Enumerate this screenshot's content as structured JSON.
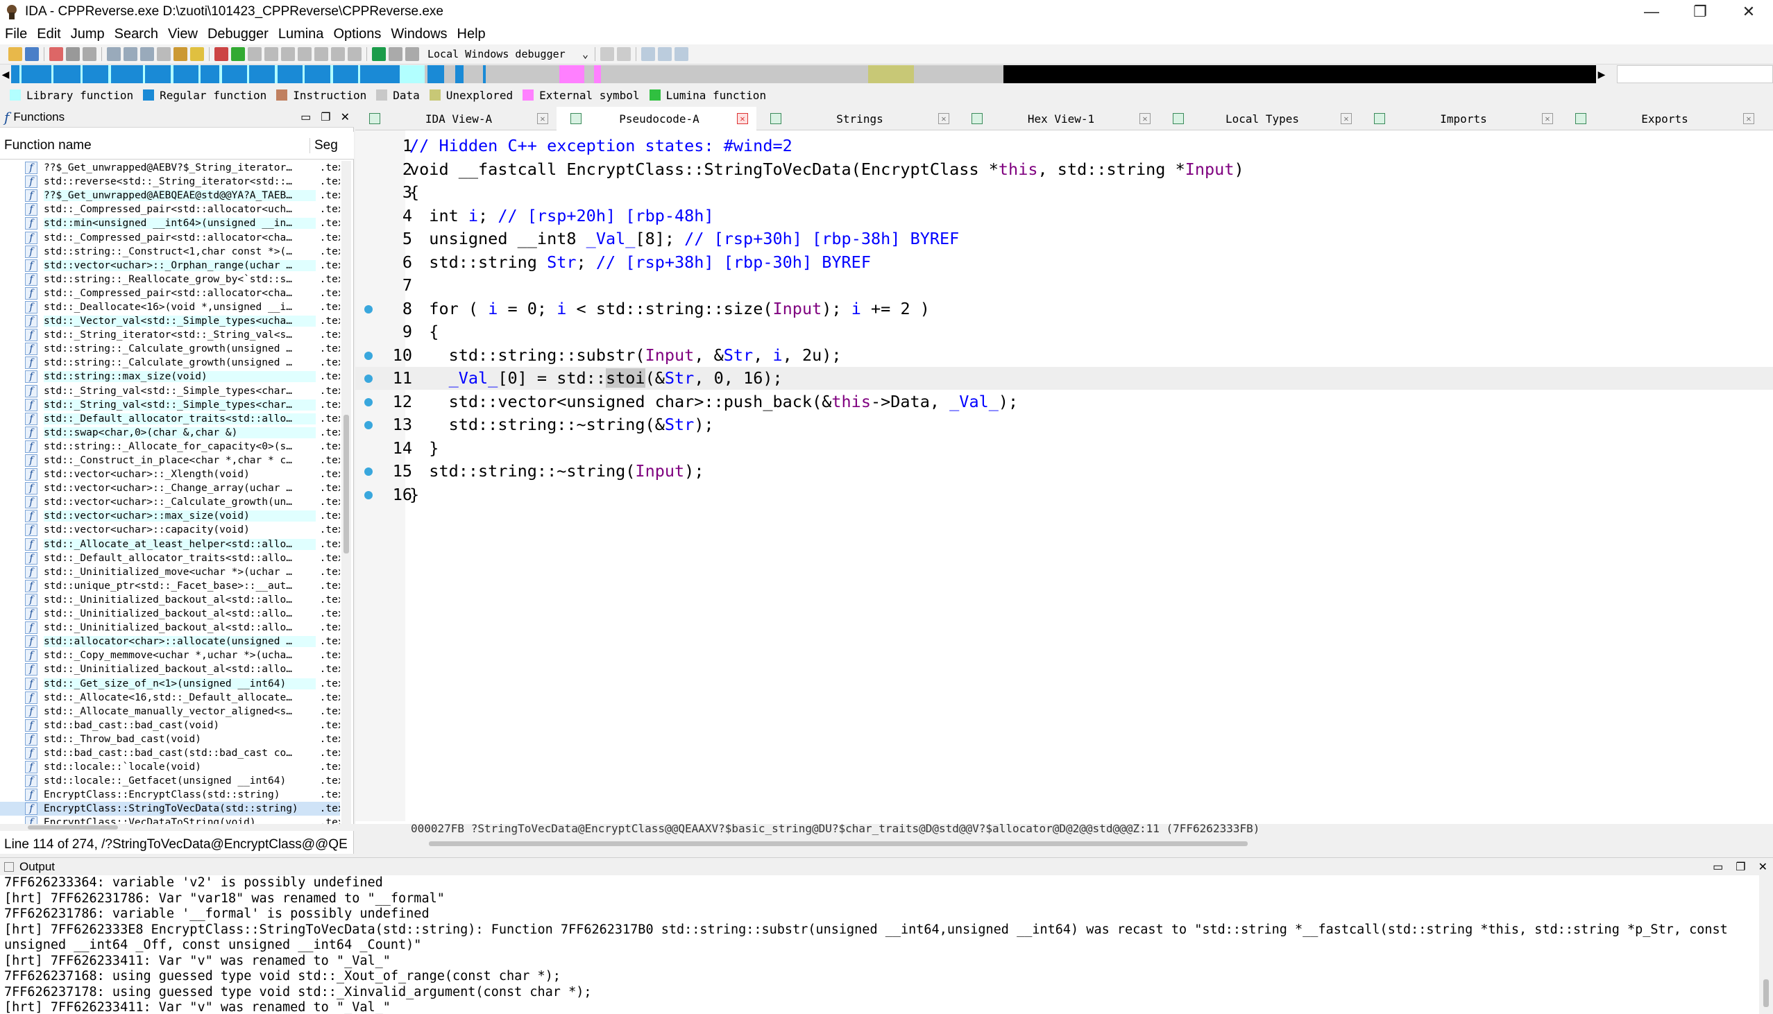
{
  "window": {
    "title": "IDA - CPPReverse.exe D:\\zuoti\\101423_CPPReverse\\CPPReverse.exe",
    "minimize_glyph": "—",
    "maximize_glyph": "❐",
    "close_glyph": "✕"
  },
  "menu": [
    "File",
    "Edit",
    "Jump",
    "Search",
    "View",
    "Debugger",
    "Lumina",
    "Options",
    "Windows",
    "Help"
  ],
  "toolbar": {
    "debugger": "Local Windows debugger"
  },
  "legend": [
    {
      "label": "Library function",
      "color": "#b2ffff"
    },
    {
      "label": "Regular function",
      "color": "#1a8ad6"
    },
    {
      "label": "Instruction",
      "color": "#c08060"
    },
    {
      "label": "Data",
      "color": "#c8c8c8"
    },
    {
      "label": "Unexplored",
      "color": "#c8c876"
    },
    {
      "label": "External symbol",
      "color": "#ff80ff"
    },
    {
      "label": "Lumina function",
      "color": "#30c040"
    }
  ],
  "functions": {
    "title": "Functions",
    "col_name": "Function name",
    "col_seg": "Seg",
    "items": [
      {
        "name": "??$_Get_unwrapped@AEBV?$_String_iterator…",
        "seg": ".tex",
        "lib": false
      },
      {
        "name": "std::reverse<std::_String_iterator<std::…",
        "seg": ".tex",
        "lib": false
      },
      {
        "name": "??$_Get_unwrapped@AEBQEAE@std@@YA?A_TAEB…",
        "seg": ".tex",
        "lib": true
      },
      {
        "name": "std::_Compressed_pair<std::allocator<uch…",
        "seg": ".tex",
        "lib": false
      },
      {
        "name": "std::min<unsigned __int64>(unsigned __in…",
        "seg": ".tex",
        "lib": true
      },
      {
        "name": "std::_Compressed_pair<std::allocator<cha…",
        "seg": ".tex",
        "lib": false
      },
      {
        "name": "std::string::_Construct<1,char const *>(…",
        "seg": ".tex",
        "lib": false
      },
      {
        "name": "std::vector<uchar>::_Orphan_range(uchar …",
        "seg": ".tex",
        "lib": true
      },
      {
        "name": "std::string::_Reallocate_grow_by<`std::s…",
        "seg": ".tex",
        "lib": false
      },
      {
        "name": "std::_Compressed_pair<std::allocator<cha…",
        "seg": ".tex",
        "lib": false
      },
      {
        "name": "std::_Deallocate<16>(void *,unsigned __i…",
        "seg": ".tex",
        "lib": false
      },
      {
        "name": "std::_Vector_val<std::_Simple_types<ucha…",
        "seg": ".tex",
        "lib": true
      },
      {
        "name": "std::_String_iterator<std::_String_val<s…",
        "seg": ".tex",
        "lib": false
      },
      {
        "name": "std::string::_Calculate_growth(unsigned …",
        "seg": ".tex",
        "lib": false
      },
      {
        "name": "std::string::_Calculate_growth(unsigned …",
        "seg": ".tex",
        "lib": false
      },
      {
        "name": "std::string::max_size(void)",
        "seg": ".tex",
        "lib": true
      },
      {
        "name": "std::_String_val<std::_Simple_types<char…",
        "seg": ".tex",
        "lib": false
      },
      {
        "name": "std::_String_val<std::_Simple_types<char…",
        "seg": ".tex",
        "lib": true
      },
      {
        "name": "std::_Default_allocator_traits<std::allo…",
        "seg": ".tex",
        "lib": true
      },
      {
        "name": "std::swap<char,0>(char &,char &)",
        "seg": ".tex",
        "lib": true
      },
      {
        "name": "std::string::_Allocate_for_capacity<0>(s…",
        "seg": ".tex",
        "lib": false
      },
      {
        "name": "std::_Construct_in_place<char *,char * c…",
        "seg": ".tex",
        "lib": false
      },
      {
        "name": "std::vector<uchar>::_Xlength(void)",
        "seg": ".tex",
        "lib": false
      },
      {
        "name": "std::vector<uchar>::_Change_array(uchar …",
        "seg": ".tex",
        "lib": false
      },
      {
        "name": "std::vector<uchar>::_Calculate_growth(un…",
        "seg": ".tex",
        "lib": false
      },
      {
        "name": "std::vector<uchar>::max_size(void)",
        "seg": ".tex",
        "lib": true
      },
      {
        "name": "std::vector<uchar>::capacity(void)",
        "seg": ".tex",
        "lib": false
      },
      {
        "name": "std::_Allocate_at_least_helper<std::allo…",
        "seg": ".tex",
        "lib": true
      },
      {
        "name": "std::_Default_allocator_traits<std::allo…",
        "seg": ".tex",
        "lib": false
      },
      {
        "name": "std::_Uninitialized_move<uchar *>(uchar …",
        "seg": ".tex",
        "lib": false
      },
      {
        "name": "std::unique_ptr<std::_Facet_base>::__aut…",
        "seg": ".tex",
        "lib": false
      },
      {
        "name": "std::_Uninitialized_backout_al<std::allo…",
        "seg": ".tex",
        "lib": false
      },
      {
        "name": "std::_Uninitialized_backout_al<std::allo…",
        "seg": ".tex",
        "lib": false
      },
      {
        "name": "std::_Uninitialized_backout_al<std::allo…",
        "seg": ".tex",
        "lib": false
      },
      {
        "name": "std::allocator<char>::allocate(unsigned …",
        "seg": ".tex",
        "lib": true
      },
      {
        "name": "std::_Copy_memmove<uchar *,uchar *>(ucha…",
        "seg": ".tex",
        "lib": false
      },
      {
        "name": "std::_Uninitialized_backout_al<std::allo…",
        "seg": ".tex",
        "lib": false
      },
      {
        "name": "std::_Get_size_of_n<1>(unsigned __int64)",
        "seg": ".tex",
        "lib": true
      },
      {
        "name": "std::_Allocate<16,std::_Default_allocate…",
        "seg": ".tex",
        "lib": false
      },
      {
        "name": "std::_Allocate_manually_vector_aligned<s…",
        "seg": ".tex",
        "lib": false
      },
      {
        "name": "std::bad_cast::bad_cast(void)",
        "seg": ".tex",
        "lib": false
      },
      {
        "name": "std::_Throw_bad_cast(void)",
        "seg": ".tex",
        "lib": false
      },
      {
        "name": "std::bad_cast::bad_cast(std::bad_cast co…",
        "seg": ".tex",
        "lib": false
      },
      {
        "name": "std::locale::`locale(void)",
        "seg": ".tex",
        "lib": false
      },
      {
        "name": "std::locale::_Getfacet(unsigned __int64)",
        "seg": ".tex",
        "lib": false
      },
      {
        "name": "EncryptClass::EncryptClass(std::string)",
        "seg": ".tex",
        "lib": false
      },
      {
        "name": "EncryptClass::StringToVecData(std::string)",
        "seg": ".tex",
        "lib": false,
        "selected": true
      },
      {
        "name": "EncryptClass::VecDataToString(void)",
        "seg": ".tex",
        "lib": false
      }
    ],
    "status": "Line 114 of 274, /?StringToVecData@EncryptClass@@QE"
  },
  "tabs": [
    {
      "label": "IDA View-A",
      "active": false
    },
    {
      "label": "Pseudocode-A",
      "active": true
    },
    {
      "label": "Strings",
      "active": false
    },
    {
      "label": "Hex View-1",
      "active": false
    },
    {
      "label": "Local Types",
      "active": false
    },
    {
      "label": "Imports",
      "active": false
    },
    {
      "label": "Exports",
      "active": false
    }
  ],
  "code": {
    "lines": [
      {
        "n": "1",
        "text": "// Hidden C++ exception states: #wind=2"
      },
      {
        "n": "2",
        "text": "void __fastcall EncryptClass::StringToVecData(EncryptClass *this, std::string *Input)"
      },
      {
        "n": "3",
        "text": "{"
      },
      {
        "n": "4",
        "text": "  int i; // [rsp+20h] [rbp-48h]"
      },
      {
        "n": "5",
        "text": "  unsigned __int8 _Val_[8]; // [rsp+30h] [rbp-38h] BYREF"
      },
      {
        "n": "6",
        "text": "  std::string Str; // [rsp+38h] [rbp-30h] BYREF"
      },
      {
        "n": "7",
        "text": ""
      },
      {
        "n": "8",
        "text": "  for ( i = 0; i < std::string::size(Input); i += 2 )"
      },
      {
        "n": "9",
        "text": "  {"
      },
      {
        "n": "10",
        "text": "    std::string::substr(Input, &Str, i, 2u);"
      },
      {
        "n": "11",
        "text": "    _Val_[0] = std::stoi(&Str, 0, 16);"
      },
      {
        "n": "12",
        "text": "    std::vector<unsigned char>::push_back(&this->Data, _Val_);"
      },
      {
        "n": "13",
        "text": "    std::string::~string(&Str);"
      },
      {
        "n": "14",
        "text": "  }"
      },
      {
        "n": "15",
        "text": "  std::string::~string(Input);"
      },
      {
        "n": "16",
        "text": "}"
      }
    ],
    "status": "000027FB ?StringToVecData@EncryptClass@@QEAAXV?$basic_string@DU?$char_traits@D@std@@V?$allocator@D@2@@std@@@Z:11 (7FF6262333FB)"
  },
  "output": {
    "title": "Output",
    "lines": [
      "7FF626233364: variable 'v2' is possibly undefined",
      "[hrt] 7FF626231786: Var \"var18\" was renamed to \"__formal\"",
      "7FF626231786: variable '__formal' is possibly undefined",
      "[hrt] 7FF6262333E8 EncryptClass::StringToVecData(std::string): Function 7FF6262317B0 std::string::substr(unsigned __int64,unsigned __int64) was recast to \"std::string *__fastcall(std::string *this, std::string *p_Str, const",
      "unsigned __int64 _Off, const unsigned __int64 _Count)\"",
      "[hrt] 7FF626233411: Var \"v\" was renamed to \"_Val_\"",
      "7FF626237168: using guessed type void std::_Xout_of_range(const char *);",
      "7FF626237178: using guessed type void std::_Xinvalid_argument(const char *);",
      "[hrt] 7FF626233411: Var \"v\" was renamed to \"_Val_\""
    ]
  }
}
